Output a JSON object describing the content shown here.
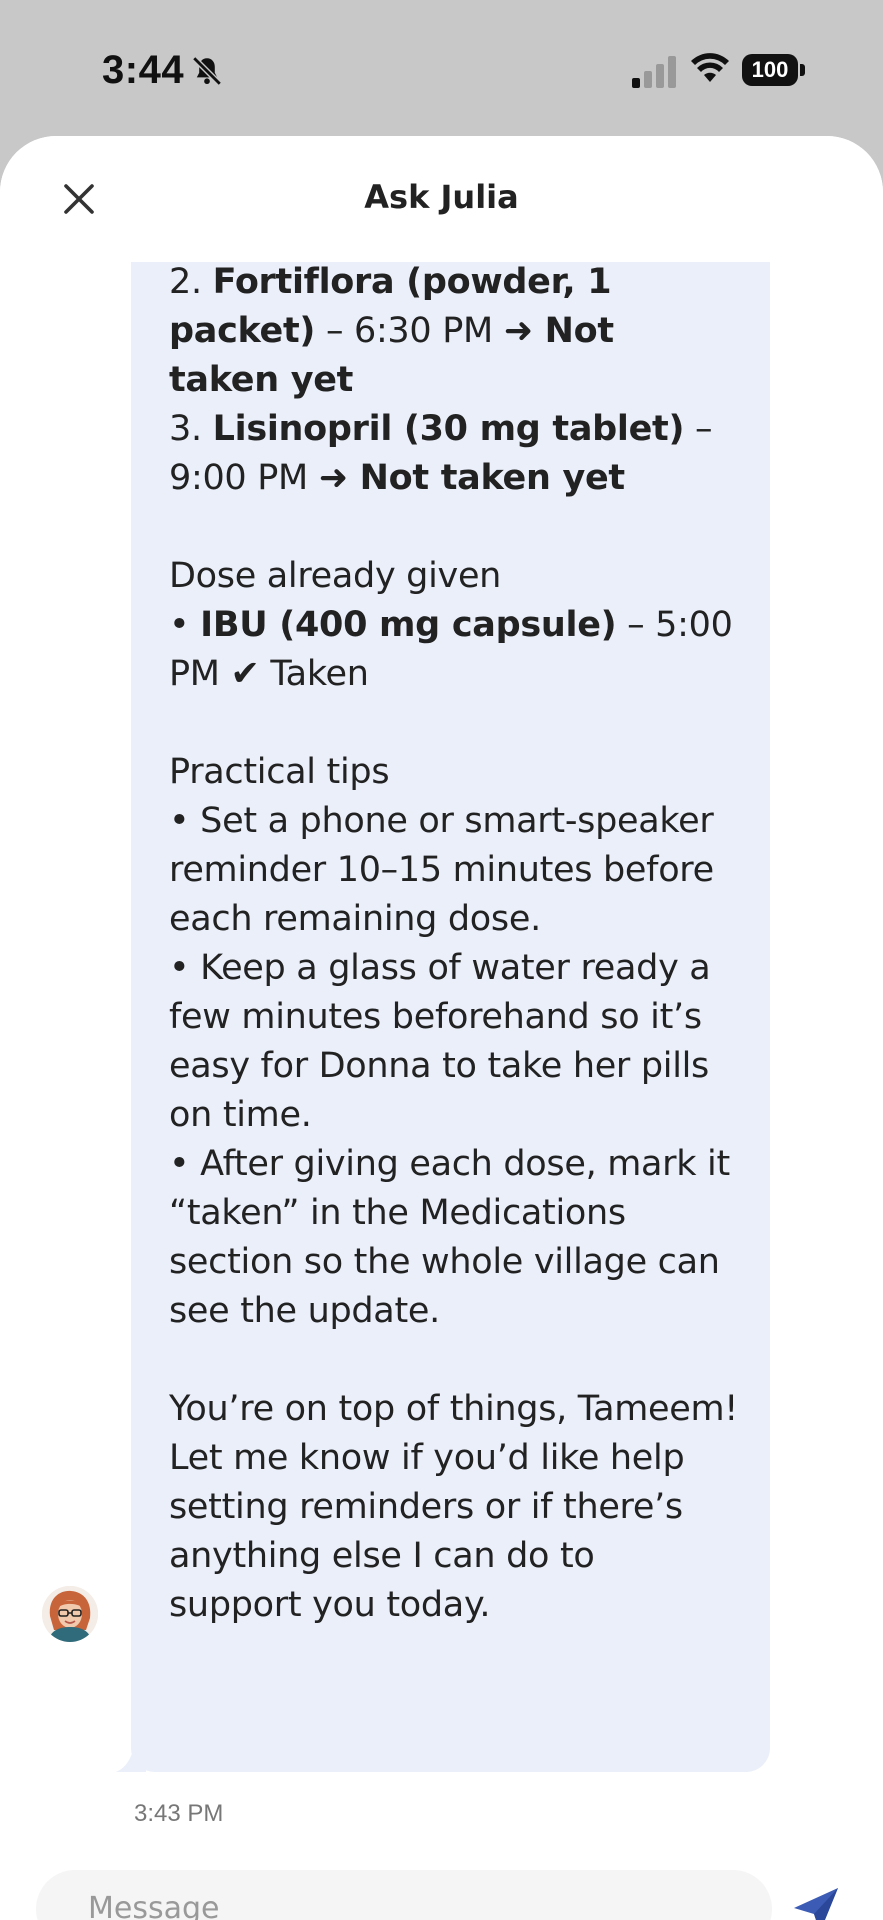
{
  "status_bar": {
    "time": "3:44",
    "battery": "100"
  },
  "header": {
    "title": "Ask Julia"
  },
  "message": {
    "lines": [
      {
        "parts": [
          {
            "t": "2. "
          },
          {
            "t": "Fortiflora (powder, 1",
            "b": true
          }
        ]
      },
      {
        "parts": [
          {
            "t": "packet)",
            "b": true
          },
          {
            "t": " – 6:30 PM  "
          },
          {
            "t": "➜ Not",
            "b": true
          }
        ]
      },
      {
        "parts": [
          {
            "t": "taken yet",
            "b": true
          }
        ]
      },
      {
        "parts": [
          {
            "t": "3. "
          },
          {
            "t": "Lisinopril (30 mg tablet)",
            "b": true
          },
          {
            "t": " –"
          }
        ]
      },
      {
        "parts": [
          {
            "t": "9:00 PM  "
          },
          {
            "t": "➜ Not taken yet",
            "b": true
          }
        ]
      },
      {
        "gap": true
      },
      {
        "parts": [
          {
            "t": "Dose already given"
          }
        ]
      },
      {
        "parts": [
          {
            "t": "• "
          },
          {
            "t": "IBU (400 mg capsule)",
            "b": true
          },
          {
            "t": " – 5:00"
          }
        ]
      },
      {
        "parts": [
          {
            "t": "PM  ✔ Taken"
          }
        ]
      },
      {
        "gap": true
      },
      {
        "parts": [
          {
            "t": "Practical tips"
          }
        ]
      },
      {
        "parts": [
          {
            "t": "• Set a phone or smart-speaker"
          }
        ]
      },
      {
        "parts": [
          {
            "t": "reminder 10–15 minutes before"
          }
        ]
      },
      {
        "parts": [
          {
            "t": "each remaining dose."
          }
        ]
      },
      {
        "parts": [
          {
            "t": "• Keep a glass of water ready a"
          }
        ]
      },
      {
        "parts": [
          {
            "t": "few minutes beforehand so it’s"
          }
        ]
      },
      {
        "parts": [
          {
            "t": "easy for Donna to take her pills"
          }
        ]
      },
      {
        "parts": [
          {
            "t": "on time."
          }
        ]
      },
      {
        "parts": [
          {
            "t": "• After giving each dose, mark it"
          }
        ]
      },
      {
        "parts": [
          {
            "t": "“taken” in the Medications"
          }
        ]
      },
      {
        "parts": [
          {
            "t": "section so the whole village can"
          }
        ]
      },
      {
        "parts": [
          {
            "t": "see the update."
          }
        ]
      },
      {
        "gap": true
      },
      {
        "parts": [
          {
            "t": "You’re on top of things, Tameem!"
          }
        ]
      },
      {
        "parts": [
          {
            "t": "Let me know if you’d like help"
          }
        ]
      },
      {
        "parts": [
          {
            "t": "setting reminders or if there’s"
          }
        ]
      },
      {
        "parts": [
          {
            "t": "anything else I can do to"
          }
        ]
      },
      {
        "parts": [
          {
            "t": "support you today."
          }
        ]
      }
    ],
    "timestamp": "3:43 PM"
  },
  "composer": {
    "placeholder": "Message"
  },
  "icons": {
    "close": "close-icon",
    "send": "send-icon",
    "bell": "bell-slash-icon",
    "signal": "cellular-signal-icon",
    "wifi": "wifi-icon",
    "avatar": "julia-avatar"
  },
  "colors": {
    "bubble": "#eaeffa",
    "accent": "#3b5bb5",
    "background": "#c8c8c8"
  }
}
